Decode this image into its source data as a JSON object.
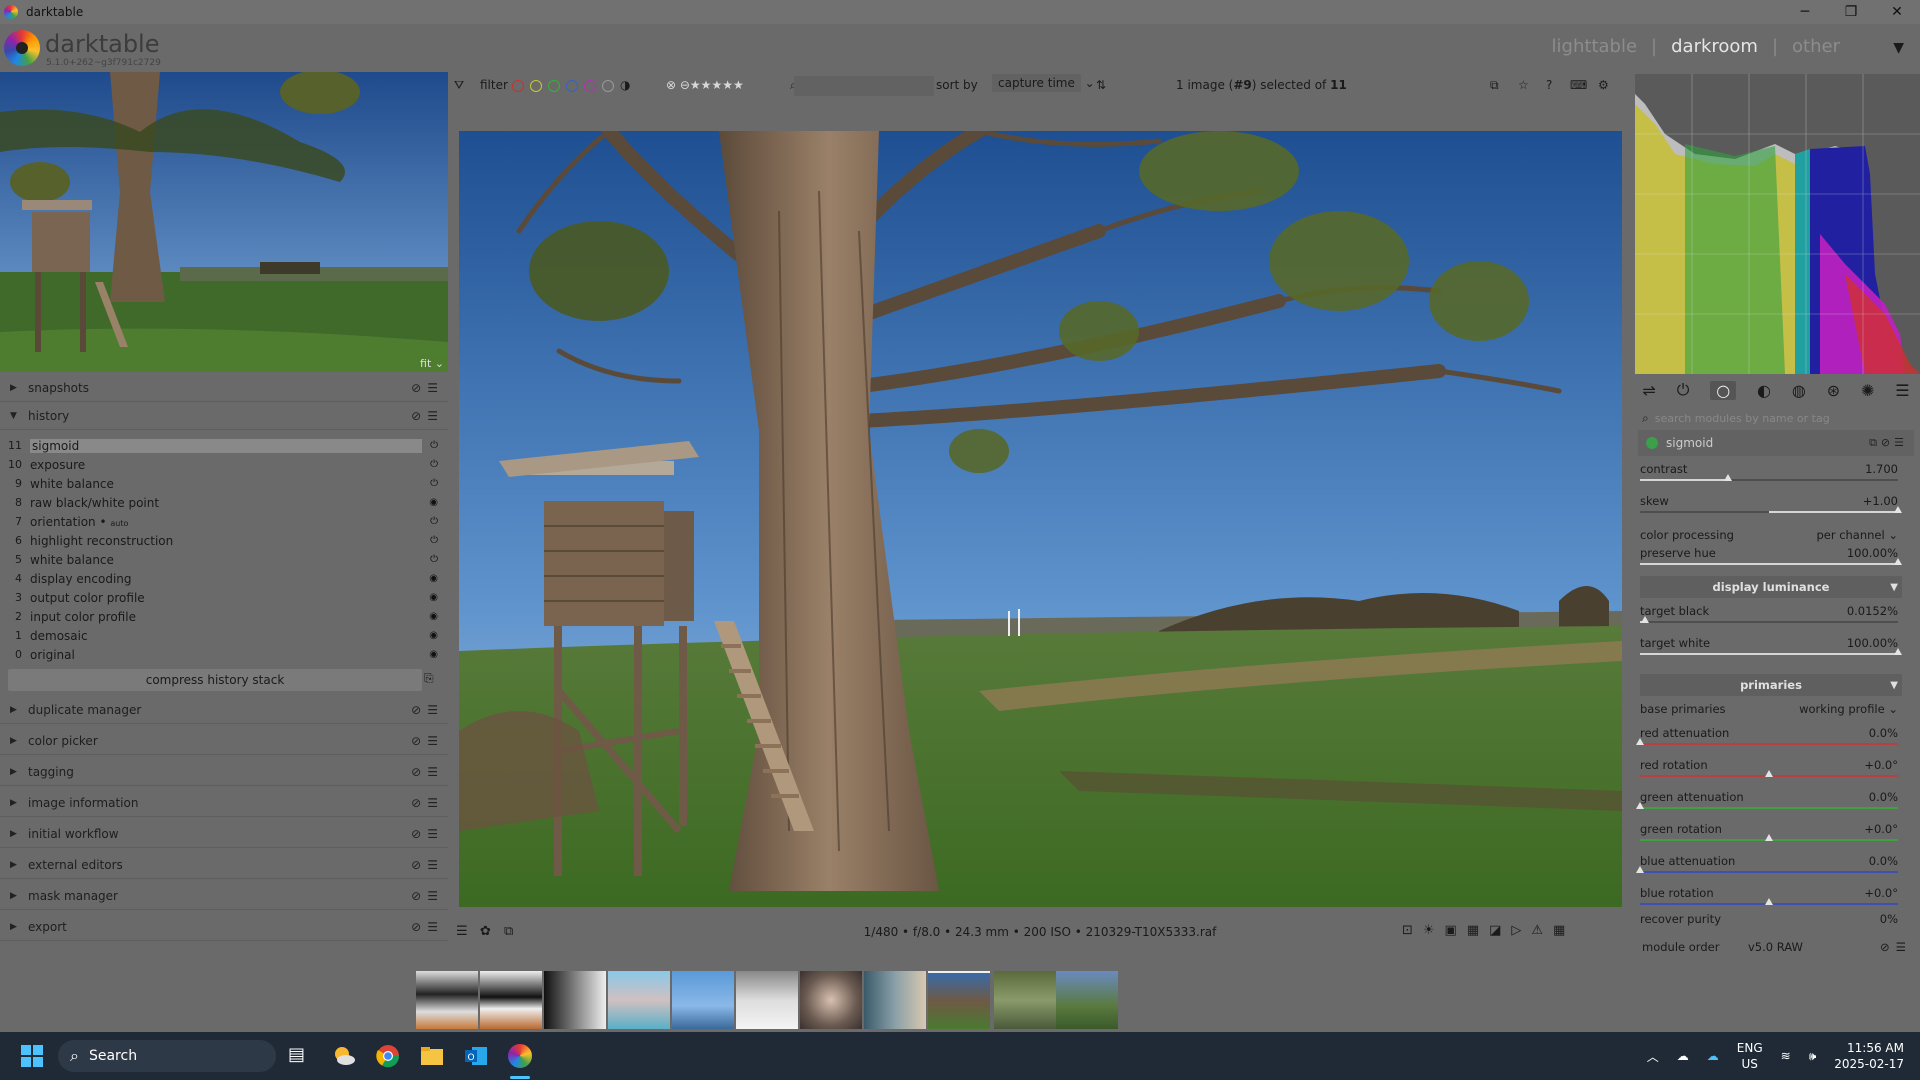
{
  "window": {
    "title": "darktable",
    "controls": [
      "─",
      "❐",
      "✕"
    ]
  },
  "header": {
    "brand": "darktable",
    "version": "5.1.0+262~g3f791c2729",
    "views": [
      "lighttable",
      "darkroom",
      "other"
    ],
    "active_view": "darkroom",
    "separator": "|"
  },
  "left_panel": {
    "nav_zoom": "fit",
    "snapshots_label": "snapshots",
    "history_label": "history",
    "history": [
      {
        "num": "11",
        "name": "sigmoid",
        "selected": true,
        "icon": "power"
      },
      {
        "num": "10",
        "name": "exposure",
        "icon": "power"
      },
      {
        "num": "9",
        "name": "white balance",
        "icon": "power"
      },
      {
        "num": "8",
        "name": "raw black/white point",
        "icon": "always-on"
      },
      {
        "num": "7",
        "name": "orientation",
        "suffix": "auto",
        "icon": "power"
      },
      {
        "num": "6",
        "name": "highlight reconstruction",
        "icon": "power"
      },
      {
        "num": "5",
        "name": "white balance",
        "icon": "power"
      },
      {
        "num": "4",
        "name": "display encoding",
        "icon": "always-on"
      },
      {
        "num": "3",
        "name": "output color profile",
        "icon": "always-on"
      },
      {
        "num": "2",
        "name": "input color profile",
        "icon": "always-on"
      },
      {
        "num": "1",
        "name": "demosaic",
        "icon": "always-on"
      },
      {
        "num": "0",
        "name": "original",
        "icon": "always-on"
      }
    ],
    "compress_label": "compress history stack",
    "modules": [
      "duplicate manager",
      "color picker",
      "tagging",
      "image information",
      "initial workflow",
      "external editors",
      "mask manager",
      "export"
    ]
  },
  "topbar": {
    "filter_label": "filter",
    "color_labels": [
      "#c83232",
      "#c8c832",
      "#32b432",
      "#3264c8",
      "#b432b4",
      "#999999"
    ],
    "sort_label": "sort by",
    "sort_value": "capture time",
    "selection_prefix": "1 image (",
    "selection_id": "#9",
    "selection_mid": ") selected of ",
    "selection_total": "11"
  },
  "image_info": "1/480 • f/8.0 • 24.3 mm • 200 ISO • 210329-T10X5333.raf",
  "right_panel": {
    "search_placeholder": "search modules by name or tag",
    "module_name": "sigmoid",
    "contrast": {
      "label": "contrast",
      "value": "1.700",
      "fraction": 0.34
    },
    "skew": {
      "label": "skew",
      "value": "+1.00",
      "fraction": 1.0
    },
    "color_processing": {
      "label": "color processing",
      "value": "per channel"
    },
    "preserve_hue": {
      "label": "preserve hue",
      "value": "100.00%",
      "fraction": 1.0
    },
    "display_luminance_label": "display luminance",
    "target_black": {
      "label": "target black",
      "value": "0.0152%",
      "fraction": 0.02
    },
    "target_white": {
      "label": "target white",
      "value": "100.00%",
      "fraction": 1.0
    },
    "primaries_label": "primaries",
    "base_primaries": {
      "label": "base primaries",
      "value": "working profile"
    },
    "primaries": [
      {
        "label": "red attenuation",
        "value": "0.0%",
        "fraction": 0.0,
        "color": "#b84040"
      },
      {
        "label": "red rotation",
        "value": "+0.0°",
        "fraction": 0.5,
        "color": "#b84040"
      },
      {
        "label": "green attenuation",
        "value": "0.0%",
        "fraction": 0.0,
        "color": "#40a040"
      },
      {
        "label": "green rotation",
        "value": "+0.0°",
        "fraction": 0.5,
        "color": "#40a040"
      },
      {
        "label": "blue attenuation",
        "value": "0.0%",
        "fraction": 0.0,
        "color": "#4050b0"
      },
      {
        "label": "blue rotation",
        "value": "+0.0°",
        "fraction": 0.5,
        "color": "#4050b0"
      }
    ],
    "recover_purity": {
      "label": "recover purity",
      "value": "0%"
    },
    "module_order_label": "module order",
    "module_order_value": "v5.0 RAW"
  },
  "taskbar": {
    "search_label": "Search",
    "lang_top": "ENG",
    "lang_bottom": "US",
    "time": "11:56 AM",
    "date": "2025-02-17"
  }
}
